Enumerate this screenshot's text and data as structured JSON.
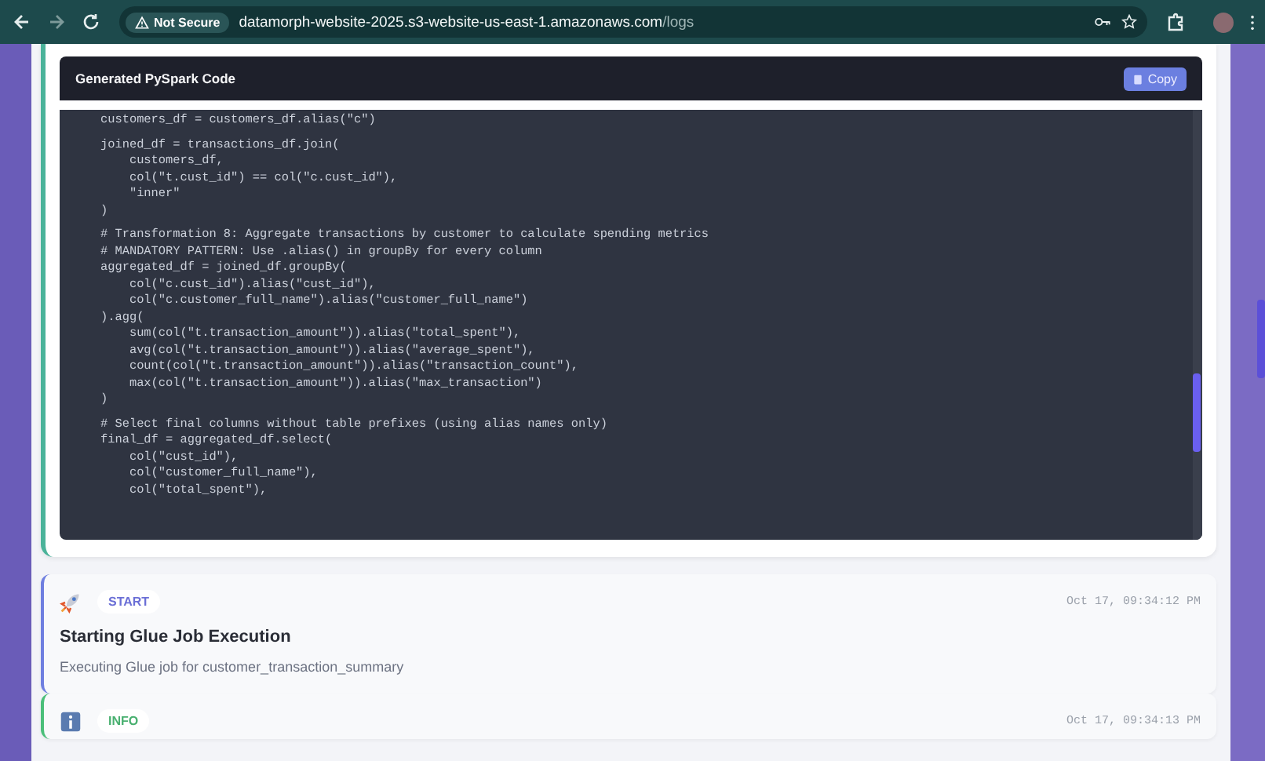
{
  "browser": {
    "security_label": "Not Secure",
    "url_host": "datamorph-website-2025.s3-website-us-east-1.amazonaws.com",
    "url_path": "/logs"
  },
  "code_panel": {
    "title": "Generated PySpark Code",
    "copy_button": "Copy",
    "blocks": [
      [
        "customers_df = customers_df.alias(\"c\")"
      ],
      [
        "joined_df = transactions_df.join(",
        "    customers_df,",
        "    col(\"t.cust_id\") == col(\"c.cust_id\"),",
        "    \"inner\"",
        ")"
      ],
      [
        "# Transformation 8: Aggregate transactions by customer to calculate spending metrics",
        "# MANDATORY PATTERN: Use .alias() in groupBy for every column",
        "aggregated_df = joined_df.groupBy(",
        "    col(\"c.cust_id\").alias(\"cust_id\"),",
        "    col(\"c.customer_full_name\").alias(\"customer_full_name\")",
        ").agg(",
        "    sum(col(\"t.transaction_amount\")).alias(\"total_spent\"),",
        "    avg(col(\"t.transaction_amount\")).alias(\"average_spent\"),",
        "    count(col(\"t.transaction_amount\")).alias(\"transaction_count\"),",
        "    max(col(\"t.transaction_amount\")).alias(\"max_transaction\")",
        ")"
      ],
      [
        "# Select final columns without table prefixes (using alias names only)",
        "final_df = aggregated_df.select(",
        "    col(\"cust_id\"),",
        "    col(\"customer_full_name\"),",
        "    col(\"total_spent\"),"
      ]
    ]
  },
  "log_entries": [
    {
      "kind": "start",
      "badge": "START",
      "timestamp": "Oct 17, 09:34:12 PM",
      "title": "Starting Glue Job Execution",
      "message": "Executing Glue job for customer_transaction_summary"
    },
    {
      "kind": "info",
      "badge": "INFO",
      "timestamp": "Oct 17, 09:34:13 PM"
    }
  ]
}
